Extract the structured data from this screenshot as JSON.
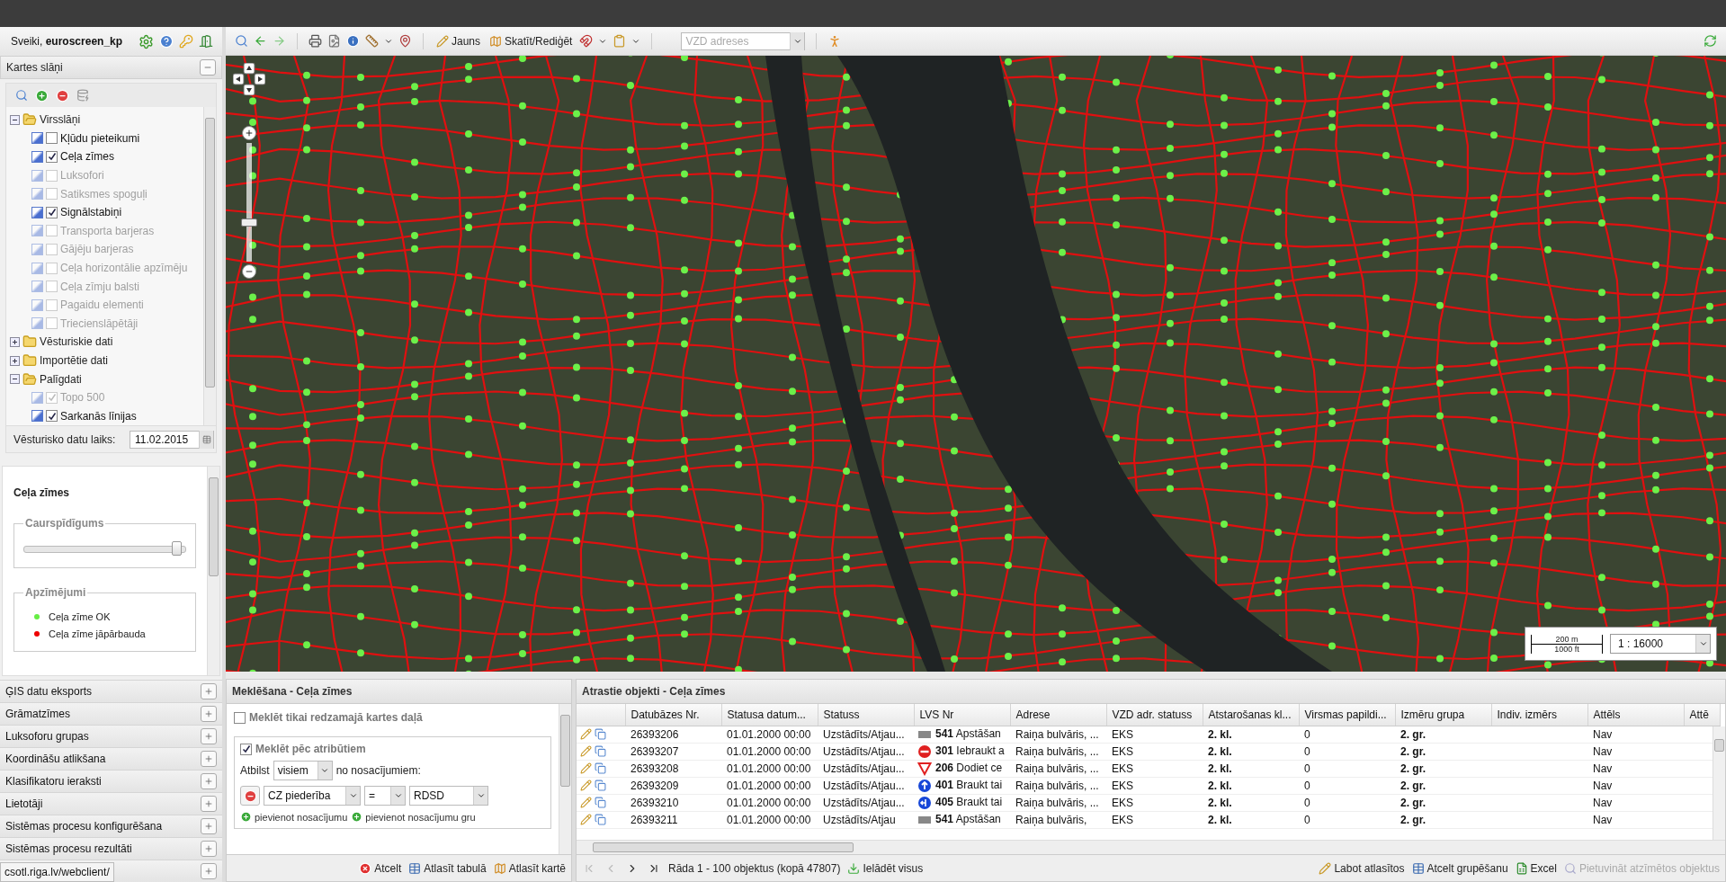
{
  "header": {
    "greeting": "Sveiki, **euroscreen_kp**"
  },
  "layers_panel": {
    "title": "Kartes slāņi",
    "tree": [
      {
        "label": "Virsslāņi",
        "expanded": true,
        "children": [
          {
            "label": "Kļūdu pieteikumi",
            "checked": false,
            "disabled": false
          },
          {
            "label": "Ceļa zīmes",
            "checked": true,
            "disabled": false
          },
          {
            "label": "Luksofori",
            "checked": false,
            "disabled": true
          },
          {
            "label": "Satiksmes spoguļi",
            "checked": false,
            "disabled": true
          },
          {
            "label": "Signālstabiņi",
            "checked": true,
            "disabled": false
          },
          {
            "label": "Transporta barjeras",
            "checked": false,
            "disabled": true
          },
          {
            "label": "Gājēju barjeras",
            "checked": false,
            "disabled": true
          },
          {
            "label": "Ceļa horizontālie apzīmēju",
            "checked": false,
            "disabled": true
          },
          {
            "label": "Ceļa zīmju balsti",
            "checked": false,
            "disabled": true
          },
          {
            "label": "Pagaidu elementi",
            "checked": false,
            "disabled": true
          },
          {
            "label": "Triecienslāpētāji",
            "checked": false,
            "disabled": true
          }
        ]
      },
      {
        "label": "Vēsturiskie dati",
        "expanded": false
      },
      {
        "label": "Importētie dati",
        "expanded": false
      },
      {
        "label": "Palīgdati",
        "expanded": true,
        "children": [
          {
            "label": "Topo 500",
            "checked": true,
            "disabled": true
          },
          {
            "label": "Sarkanās līnijas",
            "checked": true,
            "disabled": false
          }
        ]
      }
    ],
    "date_label": "Vēsturisko datu laiks:",
    "date_value": "11.02.2015"
  },
  "layer_detail": {
    "title": "Ceļa zīmes",
    "opacity_label": "Caurspīdīgums",
    "opacity": {
      "level": 0.97
    },
    "legend_label": "Apzīmējumi",
    "legend": [
      {
        "label": "Ceļa zīme OK",
        "color": "#66ee44"
      },
      {
        "label": "Ceļa zīme jāpārbauda",
        "color": "#ee0000"
      }
    ]
  },
  "accordion": [
    "ĢIS datu eksports",
    "Grāmatzīmes",
    "Luksoforu grupas",
    "Koordināšu atlikšana",
    "Klasifikatoru ieraksti",
    "Lietotāji",
    "Sistēmas procesu konfigurēšana",
    "Sistēmas procesu rezultāti"
  ],
  "status_url": "csotl.riga.lv/webclient/",
  "toolbar": {
    "new_label": "Jauns",
    "view_edit_label": "Skatīt/Rediģēt",
    "address_placeholder": "VZD adreses"
  },
  "map": {
    "zoom": {
      "level": 0.32
    },
    "scale_m": "200 m",
    "scale_ft": "1000 ft",
    "scale_select": "1 : 16000"
  },
  "search_panel": {
    "title": "Meklēšana - Ceļa zīmes",
    "visible_only": {
      "label": "Meklēt tikai redzamajā kartes daļā",
      "checked": false
    },
    "by_attributes": {
      "label": "Meklēt pēc atribūtiem",
      "checked": true
    },
    "match_label": "Atbilst",
    "match_value": "visiem",
    "match_suffix": "no nosacījumiem:",
    "condition": {
      "field": "CZ piederība",
      "operator": "=",
      "value": "RDSD"
    },
    "add_links": [
      "pievienot nosacījumu",
      "pievienot nosacījumu gru"
    ],
    "buttons": [
      {
        "kind": "cancel",
        "label": "Atcelt"
      },
      {
        "kind": "table",
        "label": "Atlasīt tabulā"
      },
      {
        "kind": "map",
        "label": "Atlasīt kartē"
      }
    ]
  },
  "results": {
    "title": "Atrastie objekti - Ceļa zīmes",
    "columns": [
      "Datubāzes Nr.",
      "Statusa datum...",
      "Statuss",
      "LVS Nr",
      "Adrese",
      "VZD adr. statuss",
      "Atstarošanas kl...",
      "Virsmas papildi...",
      "Izmēru grupa",
      "Indiv. izmērs",
      "Attēls",
      "Attē"
    ],
    "rows": [
      {
        "db_nr": "26393206",
        "status_date": "01.01.2000 00:00",
        "status": "Uzstādīts/Atjau...",
        "kind": "stop",
        "lvs": "**541** Apstāšan",
        "address": "Raiņa bulvāris, ...",
        "vzd_status": "EKS",
        "reflect": "2. kl.",
        "surface": "0",
        "size_group": "2. gr.",
        "image": "Nav"
      },
      {
        "db_nr": "26393207",
        "status_date": "01.01.2000 00:00",
        "status": "Uzstādīts/Atjau...",
        "kind": "no-entry",
        "lvs": "**301** Iebraukt a",
        "address": "Raiņa bulvāris, ...",
        "vzd_status": "EKS",
        "reflect": "2. kl.",
        "surface": "0",
        "size_group": "2. gr.",
        "image": "Nav"
      },
      {
        "db_nr": "26393208",
        "status_date": "01.01.2000 00:00",
        "status": "Uzstādīts/Atjau...",
        "kind": "yield",
        "lvs": "**206** Dodiet ce",
        "address": "Raiņa bulvāris, ...",
        "vzd_status": "EKS",
        "reflect": "2. kl.",
        "surface": "0",
        "size_group": "2. gr.",
        "image": "Nav"
      },
      {
        "db_nr": "26393209",
        "status_date": "01.01.2000 00:00",
        "status": "Uzstādīts/Atjau...",
        "kind": "ahead",
        "lvs": "**401** Braukt tai",
        "address": "Raiņa bulvāris, ...",
        "vzd_status": "EKS",
        "reflect": "2. kl.",
        "surface": "0",
        "size_group": "2. gr.",
        "image": "Nav"
      },
      {
        "db_nr": "26393210",
        "status_date": "01.01.2000 00:00",
        "status": "Uzstādīts/Atjau...",
        "kind": "ahead-left",
        "lvs": "**405** Braukt tai",
        "address": "Raiņa bulvāris, ...",
        "vzd_status": "EKS",
        "reflect": "2. kl.",
        "surface": "0",
        "size_group": "2. gr.",
        "image": "Nav"
      },
      {
        "db_nr": "26393211",
        "status_date": "01.01.2000 00:00",
        "status": "Uzstādīts/Atjau",
        "kind": "stop",
        "lvs": "**541** Apstāšan",
        "address": "Raiņa bulvāris,",
        "vzd_status": "EKS",
        "reflect": "2. kl.",
        "surface": "0",
        "size_group": "2. gr.",
        "image": "Nav"
      }
    ],
    "pager": [
      {
        "kind": "first",
        "disabled": true
      },
      {
        "kind": "prev",
        "disabled": true
      },
      {
        "kind": "next",
        "disabled": false
      },
      {
        "kind": "last",
        "disabled": false
      }
    ],
    "pager_text": "Rāda 1 - 100 objektus (kopā 47807)",
    "load_all": "Ielādēt visus",
    "actions": [
      {
        "kind": "edit",
        "label": "Labot atlasītos",
        "disabled": false
      },
      {
        "kind": "ungroup",
        "label": "Atcelt grupēšanu",
        "disabled": false
      },
      {
        "kind": "excel",
        "label": "Excel",
        "disabled": false
      },
      {
        "kind": "zoom",
        "label": "Pietuvināt atzīmētos objektus",
        "disabled": true
      }
    ]
  }
}
